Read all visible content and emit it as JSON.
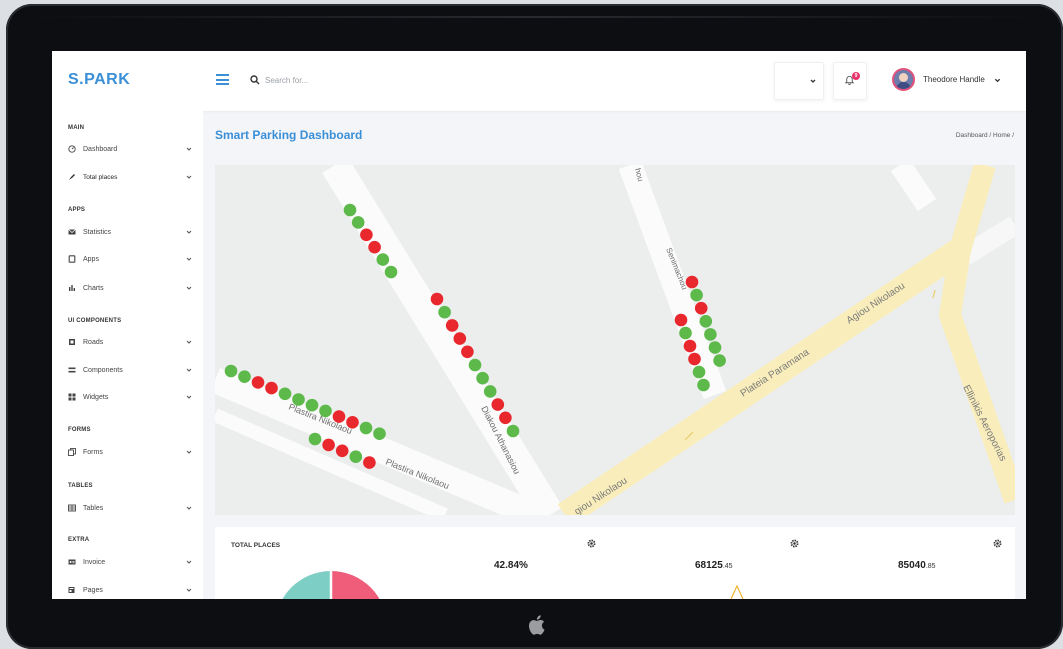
{
  "app": {
    "logo": "S.PARK"
  },
  "header": {
    "search_placeholder": "Search for...",
    "notification_count": "9",
    "user_name": "Theodore Handle"
  },
  "sidebar": {
    "sections": [
      {
        "title": "MAIN",
        "items": [
          {
            "label": "Dashboard",
            "icon": "gauge-icon"
          },
          {
            "label": "Total places",
            "icon": "rocket-icon"
          }
        ]
      },
      {
        "title": "APPS",
        "items": [
          {
            "label": "Statistics",
            "icon": "envelope-icon"
          },
          {
            "label": "Apps",
            "icon": "tablet-icon"
          },
          {
            "label": "Charts",
            "icon": "bar-chart-icon"
          }
        ]
      },
      {
        "title": "UI COMPONENTS",
        "items": [
          {
            "label": "Roads",
            "icon": "box-icon"
          },
          {
            "label": "Components",
            "icon": "list-icon"
          },
          {
            "label": "Widgets",
            "icon": "grid-icon"
          }
        ]
      },
      {
        "title": "FORMS",
        "items": [
          {
            "label": "Forms",
            "icon": "copy-icon"
          }
        ]
      },
      {
        "title": "TABLES",
        "items": [
          {
            "label": "Tables",
            "icon": "table-icon"
          }
        ]
      },
      {
        "title": "EXTRA",
        "items": [
          {
            "label": "Invoice",
            "icon": "id-card-icon"
          },
          {
            "label": "Pages",
            "icon": "file-icon"
          }
        ]
      }
    ]
  },
  "content": {
    "page_title": "Smart Parking Dashboard",
    "breadcrumb": "Dashboard / Home /"
  },
  "map": {
    "streets": {
      "plastira_1": "Plastira Nikolaou",
      "plastira_2": "Plastira Nikolaou",
      "diakou": "Diakou Athanasiou",
      "senimachou": "Senimachou",
      "plateia": "Plateia Paramana",
      "agiou_1": "Agiou Nikolaou",
      "agiou_2": "giou Nikolaou",
      "ellinikis": "Ellinikis Aeroporias",
      "top_fragment": "hou"
    },
    "spot_colors": {
      "free": "#5cb94a",
      "occupied": "#e8282d"
    },
    "spot_groups": [
      {
        "name": "diakou-north",
        "states": [
          "free",
          "free",
          "occupied",
          "occupied",
          "free",
          "free"
        ]
      },
      {
        "name": "diakou-south",
        "states": [
          "occupied",
          "free",
          "occupied",
          "occupied",
          "occupied",
          "free",
          "free",
          "free",
          "occupied",
          "occupied",
          "free"
        ]
      },
      {
        "name": "senimachou-left",
        "states": [
          "occupied",
          "free",
          "occupied",
          "occupied",
          "free",
          "free"
        ]
      },
      {
        "name": "senimachou-right",
        "states": [
          "occupied",
          "free",
          "occupied",
          "free",
          "free",
          "free",
          "free"
        ]
      },
      {
        "name": "plastira-top",
        "states": [
          "free",
          "free",
          "occupied",
          "occupied",
          "free",
          "free",
          "free",
          "free",
          "occupied",
          "occupied",
          "free",
          "free"
        ]
      },
      {
        "name": "plastira-bottom",
        "states": [
          "free",
          "occupied",
          "occupied",
          "free",
          "occupied"
        ]
      }
    ]
  },
  "stats": {
    "title": "TOTAL PLACES",
    "values": [
      {
        "main": "42.84%",
        "small": ""
      },
      {
        "main": "68125",
        "small": ".45"
      },
      {
        "main": "85040",
        "small": ".85"
      }
    ]
  }
}
